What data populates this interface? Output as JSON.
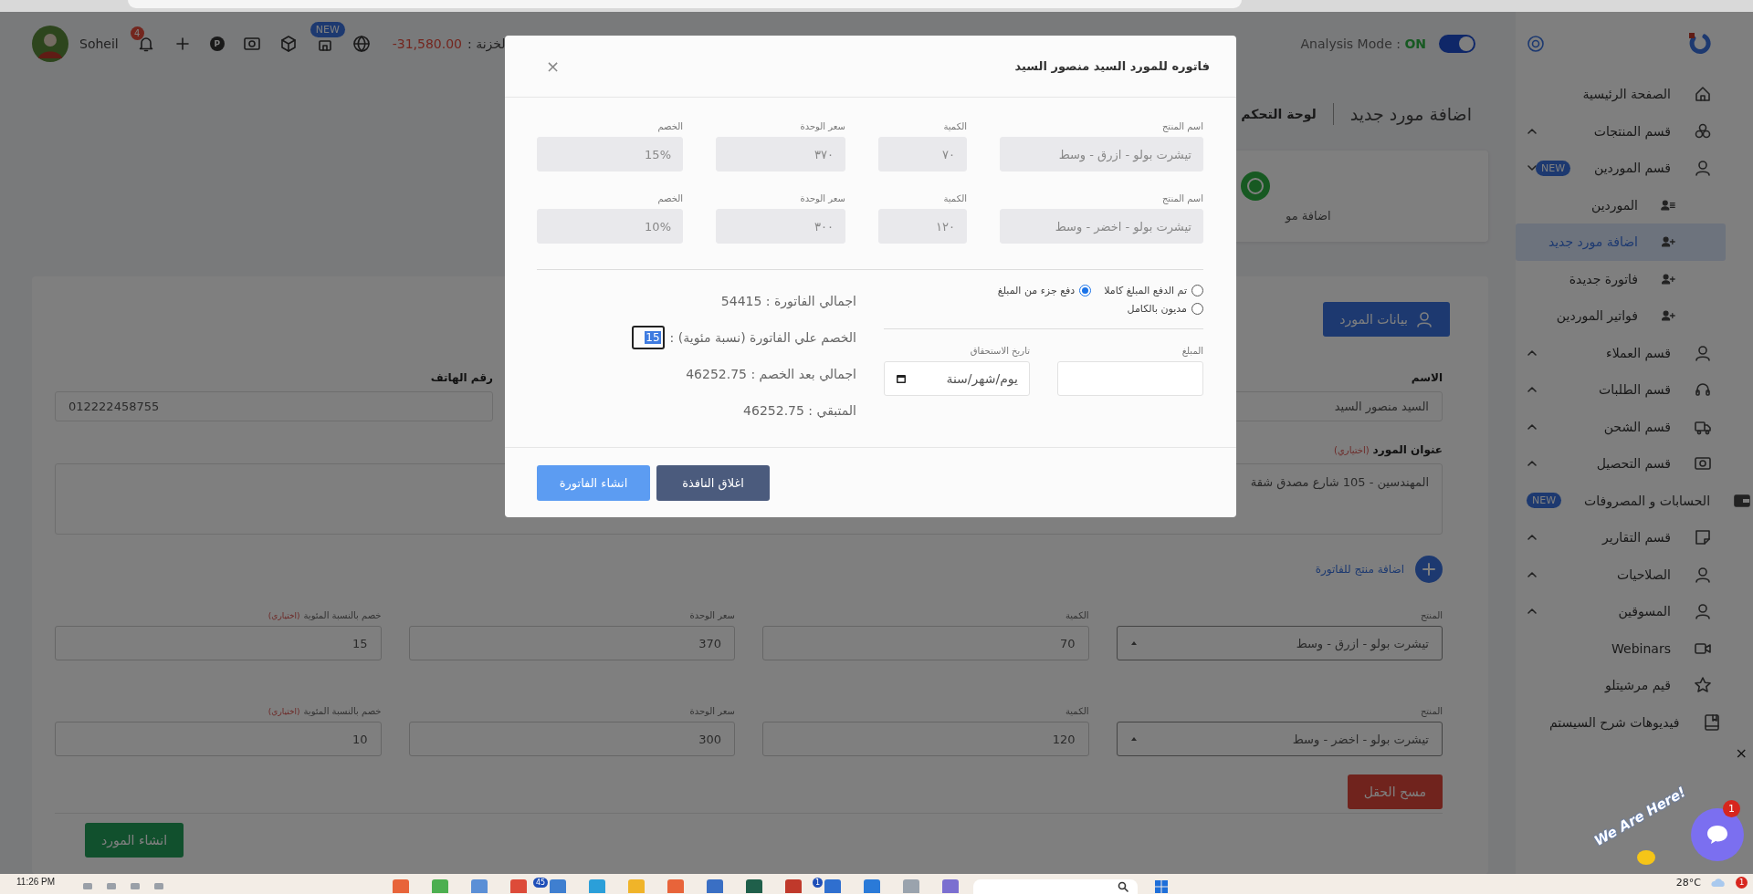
{
  "top_bar": {
    "user_name": "Soheil",
    "notification_count": "4",
    "points_letter": "P",
    "new_badge": "NEW",
    "balance_amount": "-31,580.00",
    "balance_label": "لخزنة :",
    "analysis_mode": {
      "label": "Analysis Mode :",
      "value": "ON",
      "on": true
    }
  },
  "breadcrumb": [
    "اضافة مورد جديد",
    "لوحة التحكم"
  ],
  "shortcut_card": {
    "label": "اضافة مو"
  },
  "form": {
    "section_button": "بيانات المورد",
    "name": {
      "label": "الاسم",
      "value": "السيد منصور السيد"
    },
    "phone": {
      "label": "رقم الهاتف",
      "value": "012222458755"
    },
    "address": {
      "label": "عنوان المورد",
      "optional": "(اختياري)",
      "value": "المهندسين - 105 شارع مصدق شقة"
    },
    "add_product": "اضافة منتج للفاتورة",
    "product_rows": [
      {
        "product_label": "المنتج",
        "product": "تيشرت بولو - ازرق - وسط",
        "quantity_label": "الكمية",
        "quantity": "70",
        "price_label": "سعر الوحدة",
        "price": "370",
        "discount_label": "خصم بالنسبة المئوية",
        "discount_optional": "(اختياري)",
        "discount": "15"
      },
      {
        "product_label": "المنتج",
        "product": "تيشرت بولو - اخضر - وسط",
        "quantity_label": "الكمية",
        "quantity": "120",
        "price_label": "سعر الوحدة",
        "price": "300",
        "discount_label": "خصم بالنسبة المئوية",
        "discount_optional": "(اختياري)",
        "discount": "10"
      }
    ],
    "clear_button": "مسح الحقل",
    "submit_button": "انشاء المورد"
  },
  "sidebar": {
    "items": [
      {
        "label": "الصفحة الرئيسية",
        "kind": "link"
      },
      {
        "label": "قسم المنتجات",
        "kind": "section",
        "expanded": false
      },
      {
        "label": "قسم الموردين",
        "kind": "section",
        "expanded": true,
        "badge": "NEW",
        "children": [
          {
            "label": "الموردين",
            "selected": false
          },
          {
            "label": "اضافة مورد جديد",
            "selected": true
          },
          {
            "label": "فاتورة جديدة",
            "selected": false
          },
          {
            "label": "فواتير الموردين",
            "selected": false
          }
        ]
      },
      {
        "label": "قسم العملاء",
        "kind": "section",
        "expanded": false
      },
      {
        "label": "قسم الطلبات",
        "kind": "section",
        "expanded": false
      },
      {
        "label": "قسم الشحن",
        "kind": "section",
        "expanded": false
      },
      {
        "label": "قسم التحصيل",
        "kind": "section",
        "expanded": false
      },
      {
        "label": "الحسابات و المصروفات",
        "kind": "link",
        "badge": "NEW"
      },
      {
        "label": "قسم التقارير",
        "kind": "section",
        "expanded": false
      },
      {
        "label": "الصلاحيات",
        "kind": "section",
        "expanded": false
      },
      {
        "label": "المسوقين",
        "kind": "section",
        "expanded": false
      },
      {
        "label": "Webinars",
        "kind": "link"
      },
      {
        "label": "قيم مرشيتلو",
        "kind": "link"
      },
      {
        "label": "فيديوهات شرح السيستم",
        "kind": "link"
      }
    ]
  },
  "invoice_dialog": {
    "title": "فاتوره للمورد السيد منصور السيد",
    "close": "×",
    "items": [
      {
        "product_label": "اسم المنتج",
        "product": "تيشرت بولو - ازرق - وسط",
        "quantity_label": "الكمية",
        "quantity": "٧٠",
        "price_label": "سعر الوحدة",
        "price": "٣٧٠",
        "discount_label": "الخصم",
        "discount": "15%"
      },
      {
        "product_label": "اسم المنتج",
        "product": "تيشرت بولو - اخضر - وسط",
        "quantity_label": "الكمية",
        "quantity": "١٢٠",
        "price_label": "سعر الوحدة",
        "price": "٣٠٠",
        "discount_label": "الخصم",
        "discount": "10%"
      }
    ],
    "totals": {
      "total": "اجمالي الفاتورة : 54415",
      "discount_label": "الخصم علي الفاتورة (نسبة مئوية) :",
      "discount_value": "15",
      "after_discount": "اجمالي بعد الخصم : 46252.75",
      "remaining": "المتبقي : 46252.75"
    },
    "payment_options": [
      {
        "label": "تم الدفع المبلغ كاملا",
        "selected": false
      },
      {
        "label": "دفع جزء من المبلغ",
        "selected": true
      },
      {
        "label": "مديون بالكامل",
        "selected": false
      }
    ],
    "amount": {
      "label": "المبلغ"
    },
    "due_date": {
      "label": "تاريخ الاستحقاق",
      "placeholder": "يوم/شهر/سنة"
    },
    "buttons": [
      {
        "label": "اغلاق النافذة",
        "kind": "secondary"
      },
      {
        "label": "انشاء الفاتورة",
        "kind": "primary"
      }
    ]
  },
  "chat_widget": {
    "caption": "We Are Here!",
    "badge": "1",
    "close": "×"
  },
  "taskbar": {
    "time": "11:26 PM",
    "temperature": "28°C",
    "weather_badge": "1",
    "apps": [
      {
        "color": "#7b6fd0"
      },
      {
        "color": "#9aa3ad"
      },
      {
        "color": "#2a7ad8"
      },
      {
        "color": "#2f6fcf",
        "badge": "1"
      },
      {
        "color": "#c0392b"
      },
      {
        "color": "#1f5f4a"
      },
      {
        "color": "#3a6fc4"
      },
      {
        "color": "#e8643a"
      },
      {
        "color": "#f0b429"
      },
      {
        "color": "#2b9fd9"
      },
      {
        "color": "#3f7fd0",
        "badge": "45"
      },
      {
        "color": "#dd4b39"
      },
      {
        "color": "#5b8fd6"
      },
      {
        "color": "#4caf50"
      },
      {
        "color": "#e8643a"
      }
    ]
  }
}
